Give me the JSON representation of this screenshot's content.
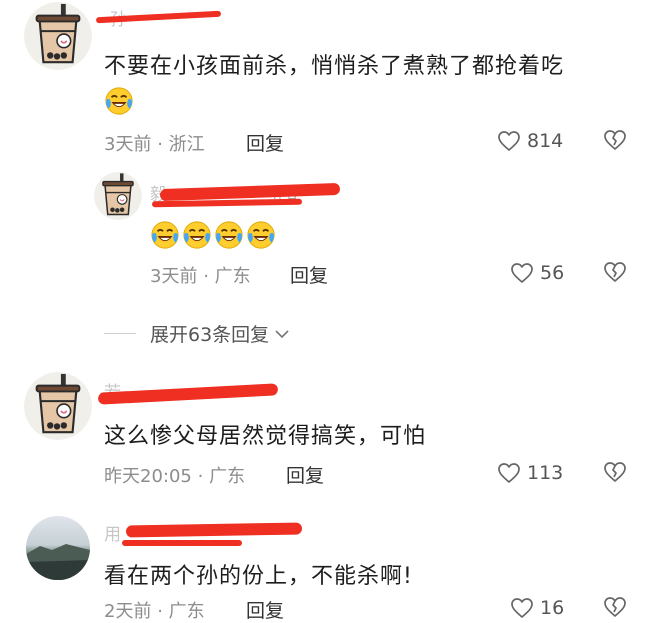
{
  "comments": [
    {
      "name": "孙",
      "text": "不要在小孩面前杀，悄悄杀了煮熟了都抢着吃",
      "time": "3天前",
      "location": "浙江",
      "reply_label": "回复",
      "likes": "814",
      "emoji_count": 1
    },
    {
      "name": "毅",
      "tag": "作者",
      "text": "",
      "time": "3天前",
      "location": "广东",
      "reply_label": "回复",
      "likes": "56",
      "emoji_count": 4
    },
    {
      "name": "若",
      "text": "这么惨父母居然觉得搞笑，可怕",
      "time": "昨天20:05",
      "location": "广东",
      "reply_label": "回复",
      "likes": "113"
    },
    {
      "name": "用",
      "text": "看在两个孙的份上，不能杀啊!",
      "time": "2天前",
      "location": "广东",
      "reply_label": "回复",
      "likes": "16"
    }
  ],
  "expand_label": "展开63条回复",
  "meta_separator": "·",
  "icons": {
    "like": "heart-outline-icon",
    "dislike": "broken-heart-icon",
    "expand": "chevron-down-icon",
    "emoji": "laughing-tears-emoji"
  },
  "colors": {
    "redaction": "#ee2f22",
    "text": "#1d1d1d",
    "meta": "#8d8d8d"
  }
}
